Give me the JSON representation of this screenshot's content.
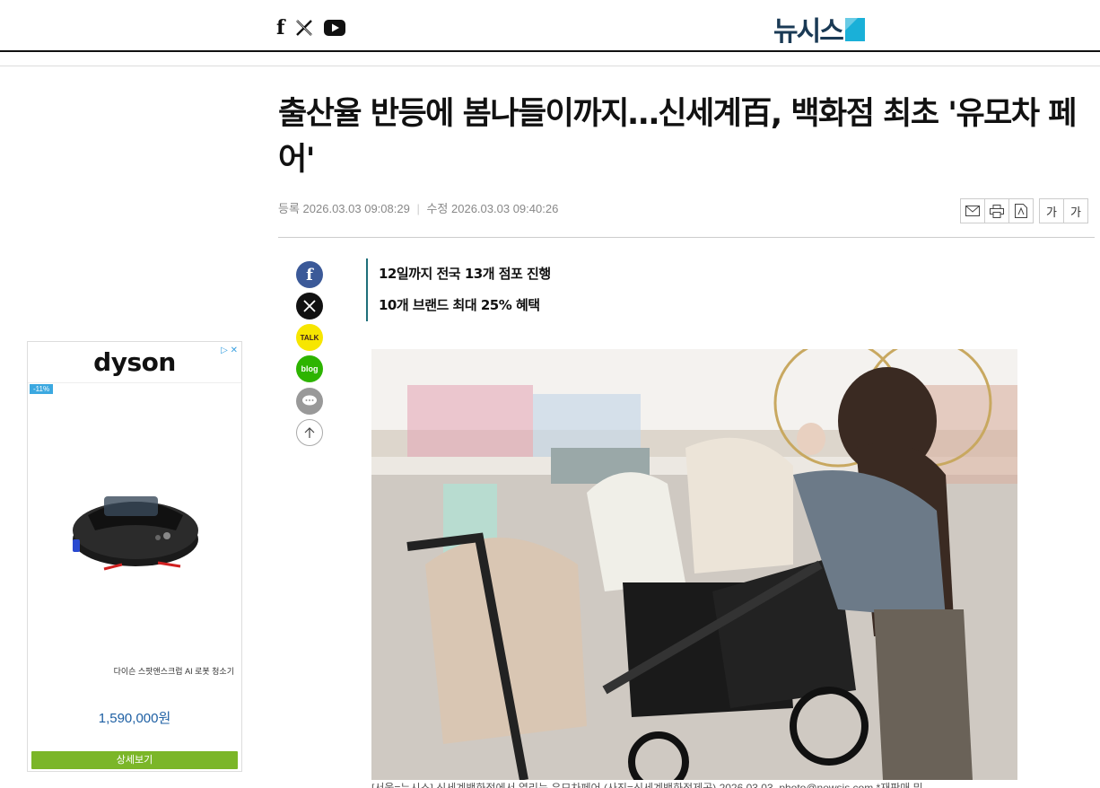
{
  "header": {
    "social": [
      "facebook-icon",
      "x-icon",
      "youtube-icon"
    ],
    "logo_text": "뉴시스"
  },
  "article": {
    "title": "출산율 반등에 봄나들이까지…신세계百, 백화점 최초 '유모차 페어'",
    "registered_label": "등록",
    "registered": "2026.03.03 09:08:29",
    "modified_label": "수정",
    "modified": "2026.03.03 09:40:26",
    "summary": [
      "12일까지 전국 13개 점포 진행",
      "10개 브랜드 최대 25% 혜택"
    ],
    "font_buttons": [
      "가",
      "가"
    ],
    "caption": "[서울=뉴시스] 신세계백화점에서 열리는 유모차페어 (사진=신세계백화점제공) 2026.03.03. photo@newsis.com *재판매 및"
  },
  "share": {
    "kakao_label": "TALK",
    "blog_label": "blog"
  },
  "ad": {
    "brand": "dyson",
    "discount": "-11%",
    "product": "다이슨 스팟앤스크럽 AI 로봇 청소기",
    "price": "1,590,000원",
    "button": "상세보기"
  },
  "colors": {
    "accent": "#1e6f7a",
    "logo": "#1a3a55",
    "ad_button": "#7bb628",
    "price": "#1d5fa3"
  }
}
